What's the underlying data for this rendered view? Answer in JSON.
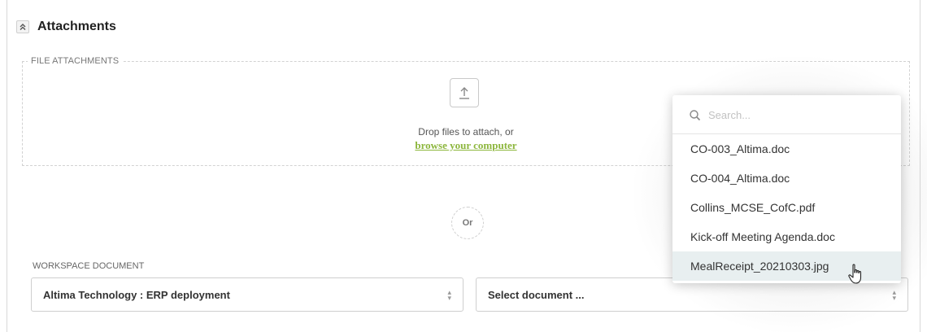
{
  "section": {
    "title": "Attachments"
  },
  "file_attachments": {
    "legend": "FILE ATTACHMENTS",
    "drop_text": "Drop files to attach, or",
    "browse_link": "browse your computer"
  },
  "divider": {
    "or_label": "Or"
  },
  "workspace": {
    "label": "WORKSPACE DOCUMENT",
    "workspace_select": "Altima Technology : ERP deployment",
    "document_select": "Select document ..."
  },
  "dropdown": {
    "search_placeholder": "Search...",
    "options": [
      {
        "label": "CO-003_Altima.doc"
      },
      {
        "label": "CO-004_Altima.doc"
      },
      {
        "label": "Collins_MCSE_CofC.pdf"
      },
      {
        "label": "Kick-off Meeting Agenda.doc"
      },
      {
        "label": "MealReceipt_20210303.jpg"
      }
    ],
    "highlighted_option": "MealReceipt_20210303.jpg"
  },
  "colors": {
    "link": "#8cb63c",
    "highlight": "#e8eff0",
    "border": "#cfcfcf"
  },
  "icons": {
    "collapse": "chevron-double-up-icon",
    "upload": "upload-arrow-icon",
    "search": "search-icon",
    "select_arrows": "up-down-arrows-icon",
    "cursor": "hand-pointer-icon"
  }
}
